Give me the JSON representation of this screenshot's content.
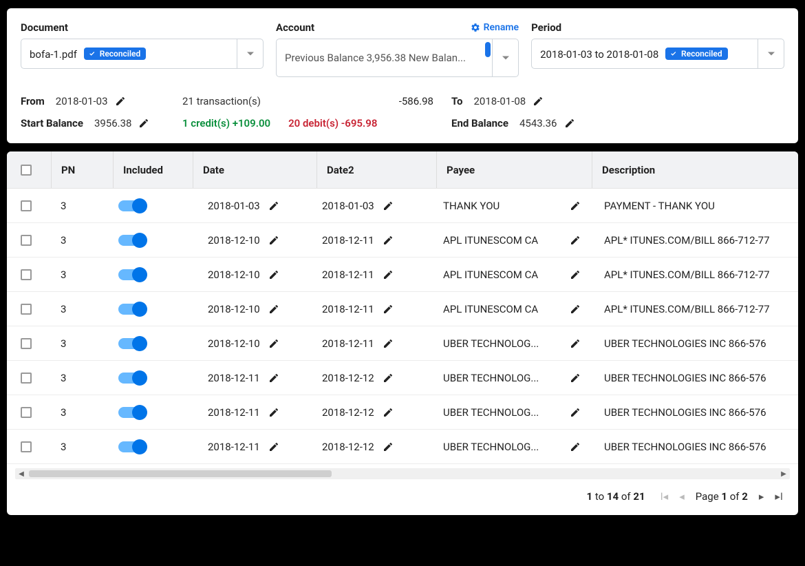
{
  "filters": {
    "document": {
      "label": "Document",
      "value": "bofa-1.pdf",
      "badge": "Reconciled"
    },
    "account": {
      "label": "Account",
      "value": "Previous Balance 3,956.38 New Balan...",
      "rename": "Rename"
    },
    "period": {
      "label": "Period",
      "value": "2018-01-03 to 2018-01-08",
      "badge": "Reconciled"
    }
  },
  "summary": {
    "from_label": "From",
    "from": "2018-01-03",
    "to_label": "To",
    "to": "2018-01-08",
    "start_balance_label": "Start Balance",
    "start_balance": "3956.38",
    "end_balance_label": "End Balance",
    "end_balance": "4543.36",
    "tx_count": "21 transaction(s)",
    "net": "-586.98",
    "credits": "1 credit(s) +109.00",
    "debits": "20 debit(s) -695.98"
  },
  "columns": {
    "pn": "PN",
    "included": "Included",
    "date": "Date",
    "date2": "Date2",
    "payee": "Payee",
    "description": "Description"
  },
  "rows": [
    {
      "pn": "3",
      "date": "2018-01-03",
      "date2": "2018-01-03",
      "payee": "THANK YOU",
      "desc": "PAYMENT - THANK YOU"
    },
    {
      "pn": "3",
      "date": "2018-12-10",
      "date2": "2018-12-11",
      "payee": "APL ITUNESCOM CA",
      "desc": "APL* ITUNES.COM/BILL 866-712-77"
    },
    {
      "pn": "3",
      "date": "2018-12-10",
      "date2": "2018-12-11",
      "payee": "APL ITUNESCOM CA",
      "desc": "APL* ITUNES.COM/BILL 866-712-77"
    },
    {
      "pn": "3",
      "date": "2018-12-10",
      "date2": "2018-12-11",
      "payee": "APL ITUNESCOM CA",
      "desc": "APL* ITUNES.COM/BILL 866-712-77"
    },
    {
      "pn": "3",
      "date": "2018-12-10",
      "date2": "2018-12-11",
      "payee": "UBER TECHNOLOG...",
      "desc": "UBER TECHNOLOGIES INC 866-576"
    },
    {
      "pn": "3",
      "date": "2018-12-11",
      "date2": "2018-12-12",
      "payee": "UBER TECHNOLOG...",
      "desc": "UBER TECHNOLOGIES INC 866-576"
    },
    {
      "pn": "3",
      "date": "2018-12-11",
      "date2": "2018-12-12",
      "payee": "UBER TECHNOLOG...",
      "desc": "UBER TECHNOLOGIES INC 866-576"
    },
    {
      "pn": "3",
      "date": "2018-12-11",
      "date2": "2018-12-12",
      "payee": "UBER TECHNOLOG...",
      "desc": "UBER TECHNOLOGIES INC 866-576"
    }
  ],
  "pager": {
    "from": "1",
    "to": "14",
    "total": "21",
    "page": "1",
    "pages": "2",
    "to_word": "to",
    "of_word": "of",
    "page_word": "Page"
  }
}
